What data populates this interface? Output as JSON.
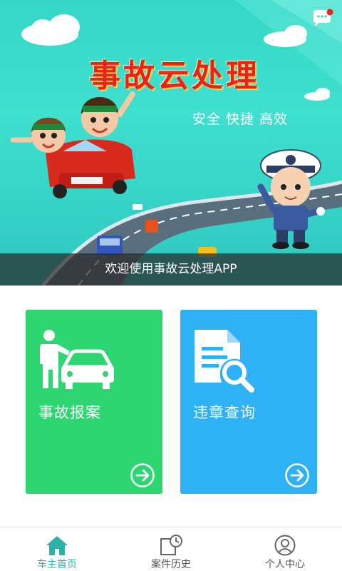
{
  "banner": {
    "title": "事故云处理",
    "slogan": "安全 快捷 高效",
    "caption": "欢迎使用事故云处理APP",
    "message_icon": "chat-bubble-icon",
    "has_unread_dot": true
  },
  "tiles": [
    {
      "label": "事故报案",
      "icon": "person-car-icon",
      "color": "#2ed672"
    },
    {
      "label": "违章查询",
      "icon": "document-search-icon",
      "color": "#2fb1f5"
    }
  ],
  "bottom_nav": {
    "items": [
      {
        "label": "车主首页",
        "icon": "home-icon",
        "active": true
      },
      {
        "label": "案件历史",
        "icon": "history-icon",
        "active": false
      },
      {
        "label": "个人中心",
        "icon": "user-icon",
        "active": false
      }
    ]
  },
  "colors": {
    "accent": "#2bb4a6",
    "banner_bg": "#3fe0cf",
    "caption_bg": "#282828",
    "unread_dot": "#e8231c"
  }
}
